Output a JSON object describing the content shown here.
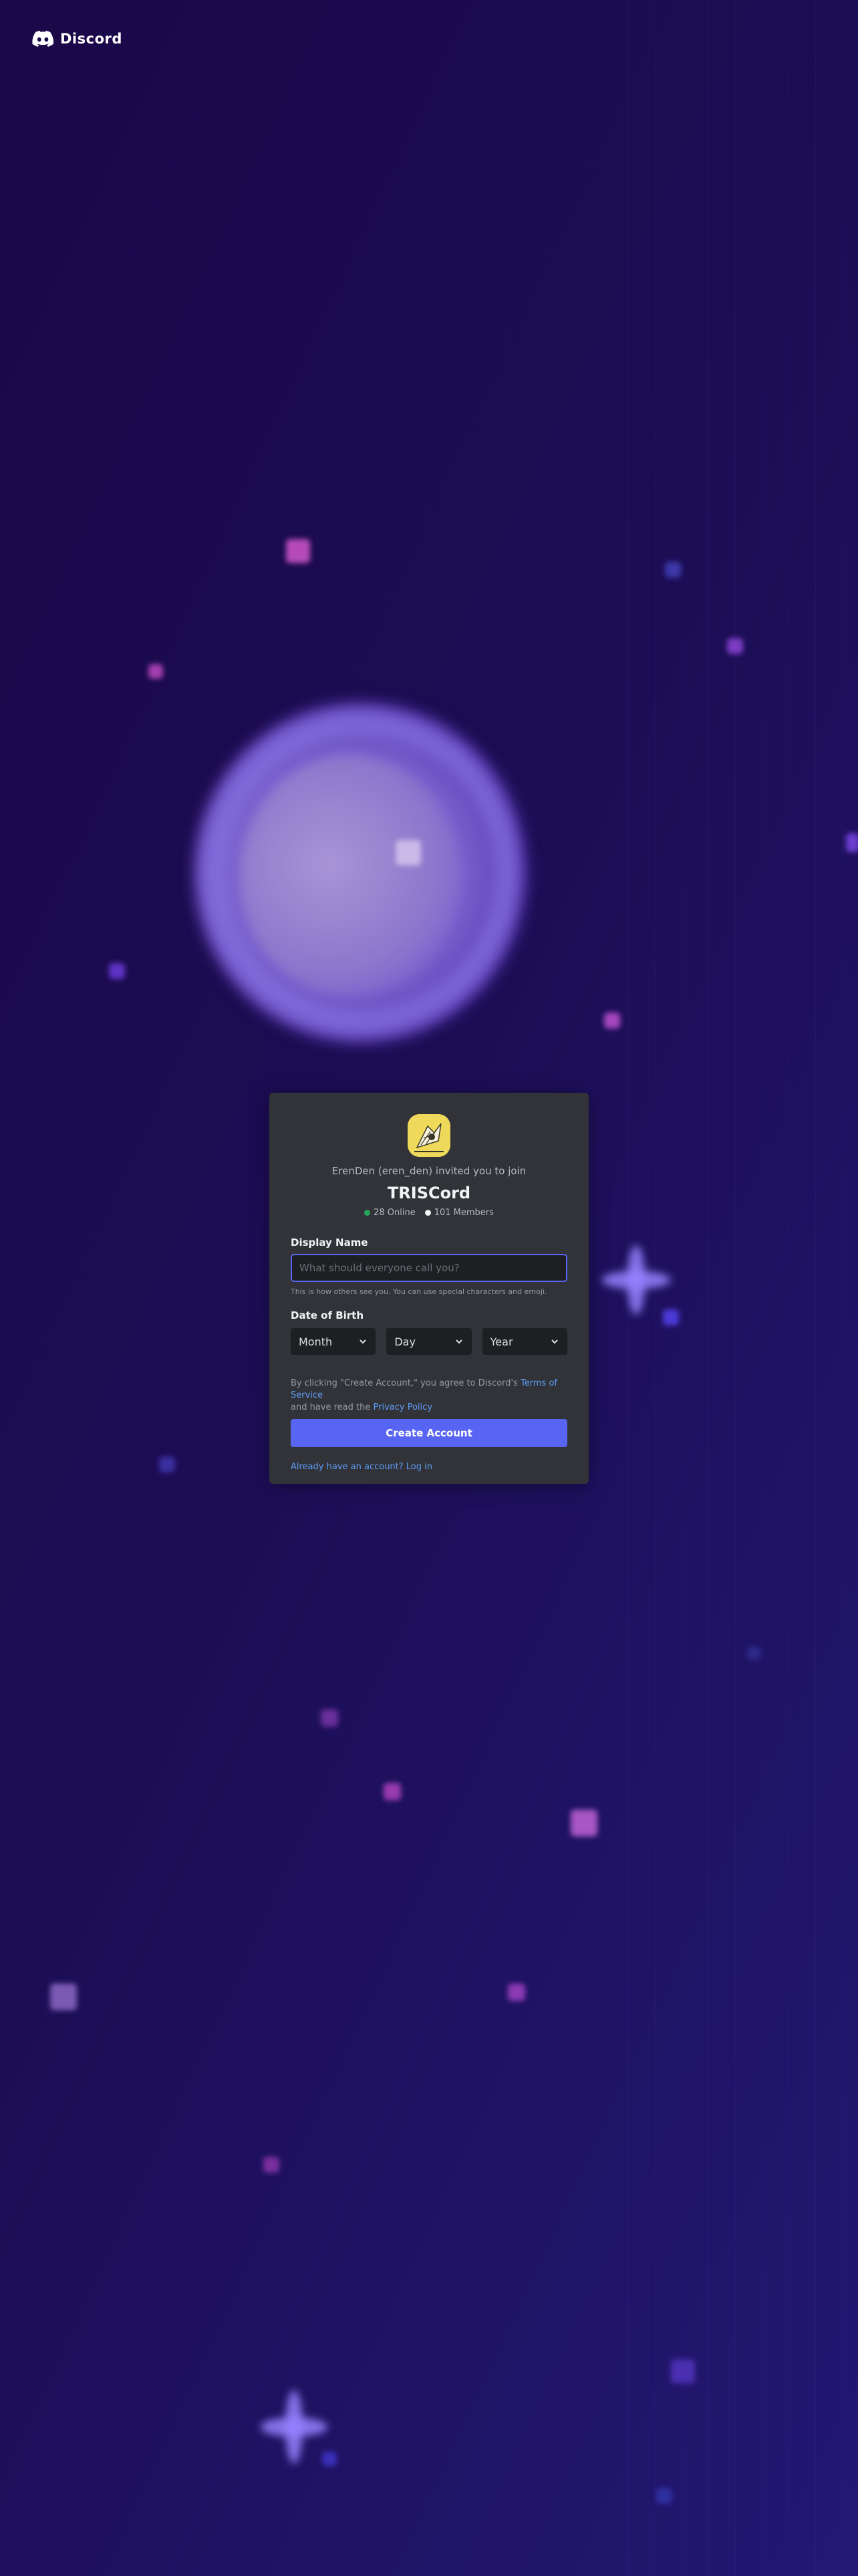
{
  "brand": {
    "name": "Discord",
    "icon": "discord-logo-icon"
  },
  "invite": {
    "inviter_text": "ErenDen (eren_den) invited you to join",
    "server_name": "TRISCord",
    "online": "28 Online",
    "members": "101 Members",
    "online_color": "#23a55a",
    "members_color": "#f2f3f5"
  },
  "form": {
    "display_name_label": "Display Name",
    "display_name_placeholder": "What should everyone call you?",
    "display_name_hint": "This is how others see you. You can use special characters and emoji.",
    "dob_label": "Date of Birth",
    "month": "Month",
    "day": "Day",
    "year": "Year",
    "legal_prefix": "By clicking \"Create Account,\" you agree to Discord's",
    "terms_link": "Terms of Service",
    "legal_middle": "and have read the",
    "privacy_link": "Privacy Policy",
    "create_button": "Create Account",
    "login_link": "Already have an account? Log in"
  },
  "colors": {
    "accent": "#5865f2",
    "card": "#313338",
    "input_bg": "#1e1f22"
  }
}
